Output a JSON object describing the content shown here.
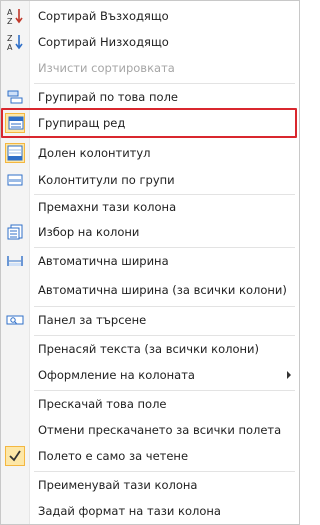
{
  "menu": {
    "sort_ascending": "Сортирай Възходящо",
    "sort_descending": "Сортирай Низходящо",
    "clear_sorting": "Изчисти сортировката",
    "group_by_field": "Групирай по това поле",
    "group_row": "Групиращ ред",
    "footer": "Долен колонтитул",
    "group_footers": "Колонтитули по групи",
    "remove_column": "Премахни тази колона",
    "column_chooser": "Избор на колони",
    "best_fit": "Автоматична ширина",
    "best_fit_all": "Автоматична ширина (за всички колони)",
    "search_panel": "Панел за търсене",
    "word_wrap_all": "Пренасяй текста (за всички колони)",
    "column_appearance": "Оформление на колоната",
    "skip_field": "Прескачай това поле",
    "unskip_all": "Отмени прескачането за всички полета",
    "read_only": "Полето е само за четене",
    "rename_column": "Преименувай тази колона",
    "format_column": "Задай формат на тази колона"
  },
  "colors": {
    "highlight_border": "#d9272e",
    "checked_bg": "#fde7a7",
    "accent_blue": "#2f6fc8"
  }
}
